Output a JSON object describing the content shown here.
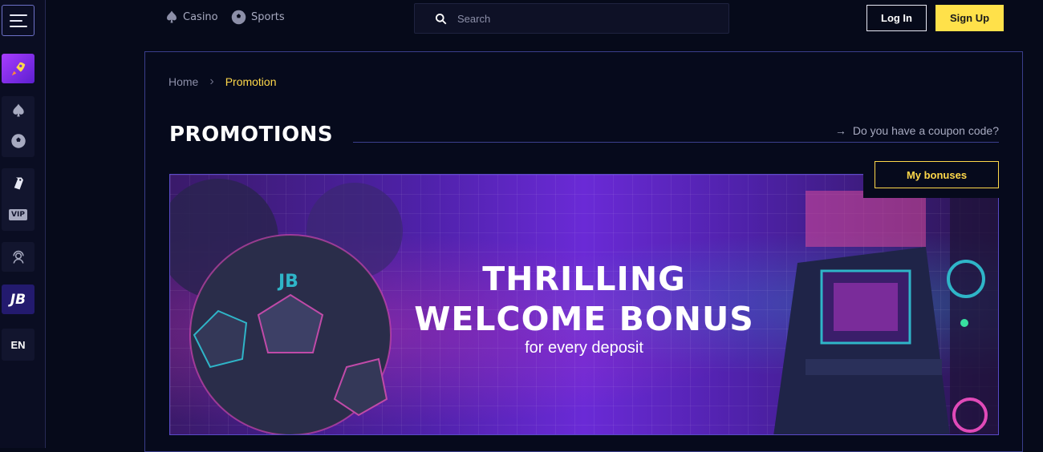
{
  "sidebar": {
    "menu_icon": "hamburger-menu-icon",
    "items": [
      {
        "icon": "rocket-icon",
        "label": ""
      },
      {
        "icon": "spade-icon",
        "label": ""
      },
      {
        "icon": "soccer-ball-icon",
        "label": ""
      },
      {
        "icon": "tag-icon",
        "label": ""
      },
      {
        "icon": "vip-icon",
        "label": "VIP"
      },
      {
        "icon": "support-agent-icon",
        "label": ""
      },
      {
        "icon": "jb-logo-icon",
        "label": "JB"
      },
      {
        "icon": "language-icon",
        "label": "EN"
      }
    ]
  },
  "topbar": {
    "casino_label": "Casino",
    "sports_label": "Sports",
    "search_placeholder": "Search",
    "login_label": "Log In",
    "signup_label": "Sign Up"
  },
  "breadcrumb": {
    "home": "Home",
    "current": "Promotion"
  },
  "page": {
    "title": "PROMOTIONS",
    "coupon_link": "Do you have a coupon code?",
    "my_bonuses_label": "My bonuses"
  },
  "banner": {
    "line1": "THRILLING",
    "line2": "WELCOME BONUS",
    "line3": "for every deposit",
    "badge": "JB"
  },
  "colors": {
    "accent_yellow": "#ffe14a",
    "panel_border": "#3a3e8c",
    "background": "#060a1a"
  }
}
